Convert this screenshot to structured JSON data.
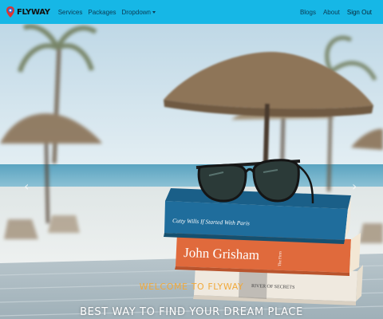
{
  "brand": {
    "name": "FLYWAY",
    "icon": "flyway-logo-icon"
  },
  "nav": {
    "left_items": [
      {
        "label": "Services"
      },
      {
        "label": "Packages"
      },
      {
        "label": "Dropdown"
      }
    ],
    "right_items": [
      {
        "label": "Blogs"
      },
      {
        "label": "About"
      },
      {
        "label": "Sign Out"
      }
    ]
  },
  "hero": {
    "welcome": "WELCOME TO FLYWAY",
    "tagline": "BEST WAY TO FIND YOUR DREAM PLACE",
    "books": {
      "top": "Cutty Wills  If Started With Paris",
      "middle": "John Grisham",
      "middle_side": "The Firm",
      "bottom": "RIVER OF SECRETS"
    }
  },
  "colors": {
    "navbar": "#16b7e6",
    "welcome": "#f0a93b",
    "tagline": "#ffffff"
  }
}
